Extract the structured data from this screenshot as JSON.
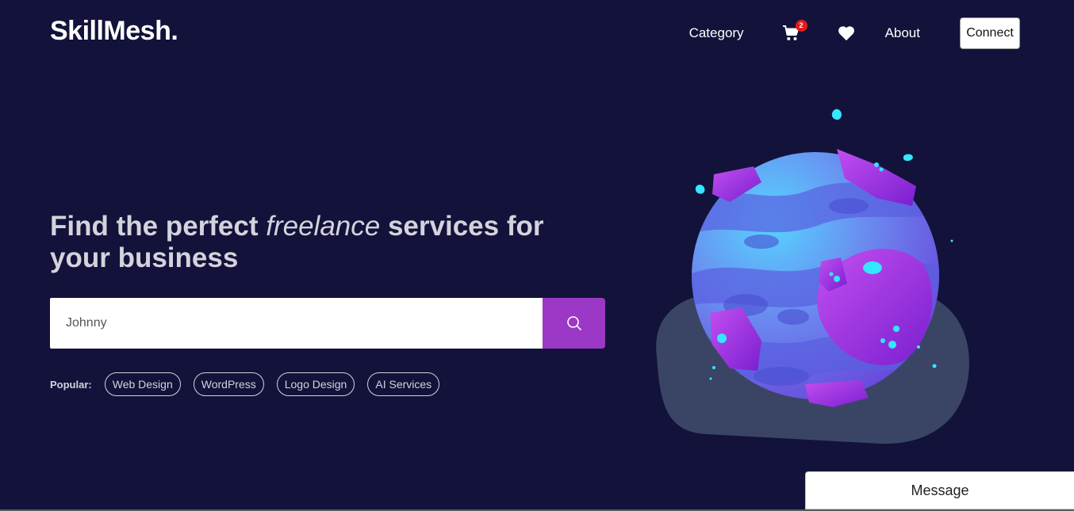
{
  "header": {
    "logo": "SkillMesh.",
    "nav": {
      "category": "Category",
      "cart_count": "2",
      "about": "About",
      "connect": "Connect"
    }
  },
  "hero": {
    "title_part1": "Find the perfect ",
    "title_italic": "freelance",
    "title_part2": " services for your business",
    "search": {
      "value": "Johnny"
    },
    "popular_label": "Popular:",
    "tags": [
      "Web Design",
      "WordPress",
      "Logo Design",
      "AI Services"
    ]
  },
  "message": {
    "label": "Message"
  },
  "colors": {
    "background": "#13123a",
    "accent": "#9b38c5",
    "badge": "#e31b1b",
    "text_muted": "#d4d2dc"
  },
  "icons": [
    "cart-icon",
    "heart-icon",
    "search-icon"
  ]
}
